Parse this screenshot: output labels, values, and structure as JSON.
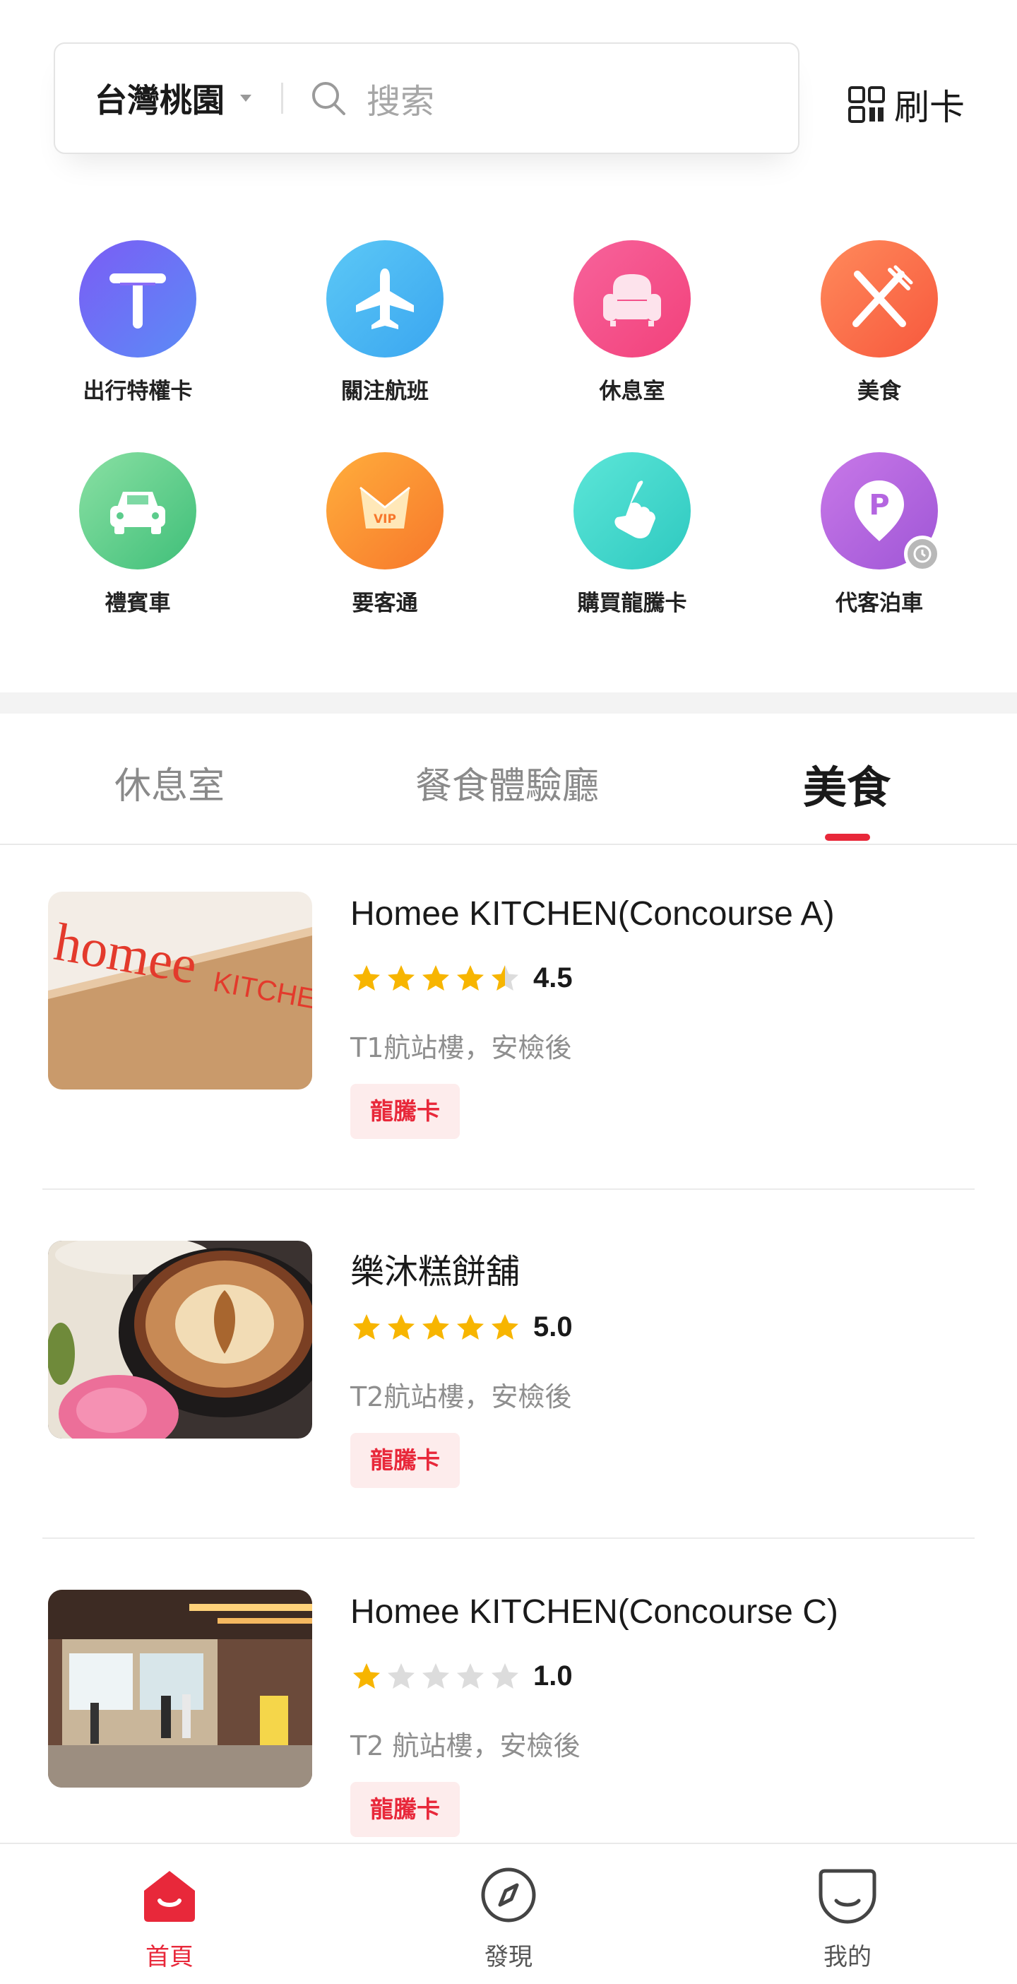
{
  "header": {
    "city": "台灣桃園",
    "search_placeholder": "搜索",
    "scan_label": "刷卡"
  },
  "quick_grid": [
    {
      "label": "出行特權卡",
      "icon": "t-card-icon"
    },
    {
      "label": "關注航班",
      "icon": "airplane-icon"
    },
    {
      "label": "休息室",
      "icon": "sofa-icon"
    },
    {
      "label": "美食",
      "icon": "fork-knife-icon"
    },
    {
      "label": "禮賓車",
      "icon": "car-icon"
    },
    {
      "label": "要客通",
      "icon": "vip-crown-icon"
    },
    {
      "label": "購買龍騰卡",
      "icon": "hand-tap-icon"
    },
    {
      "label": "代客泊車",
      "icon": "parking-pin-icon"
    }
  ],
  "tabs": [
    {
      "label": "休息室",
      "active": false
    },
    {
      "label": "餐食體驗廳",
      "active": false
    },
    {
      "label": "美食",
      "active": true
    }
  ],
  "listings": [
    {
      "title": "Homee KITCHEN(Concourse A)",
      "rating": 4.5,
      "rating_text": "4.5",
      "location": "T1航站樓，安檢後",
      "badge": "龍騰卡"
    },
    {
      "title": "樂沐糕餅舖",
      "rating": 5.0,
      "rating_text": "5.0",
      "location": "T2航站樓，安檢後",
      "badge": "龍騰卡"
    },
    {
      "title": "Homee KITCHEN(Concourse C)",
      "rating": 1.0,
      "rating_text": "1.0",
      "location": "T2 航站樓，安檢後",
      "badge": "龍騰卡"
    }
  ],
  "bottom_nav": [
    {
      "label": "首頁",
      "icon": "home-icon",
      "active": true
    },
    {
      "label": "發現",
      "icon": "compass-icon",
      "active": false
    },
    {
      "label": "我的",
      "icon": "profile-face-icon",
      "active": false
    }
  ],
  "colors": {
    "accent": "#e8283a",
    "star": "#f7b500",
    "star_empty": "#dcdcdc"
  }
}
